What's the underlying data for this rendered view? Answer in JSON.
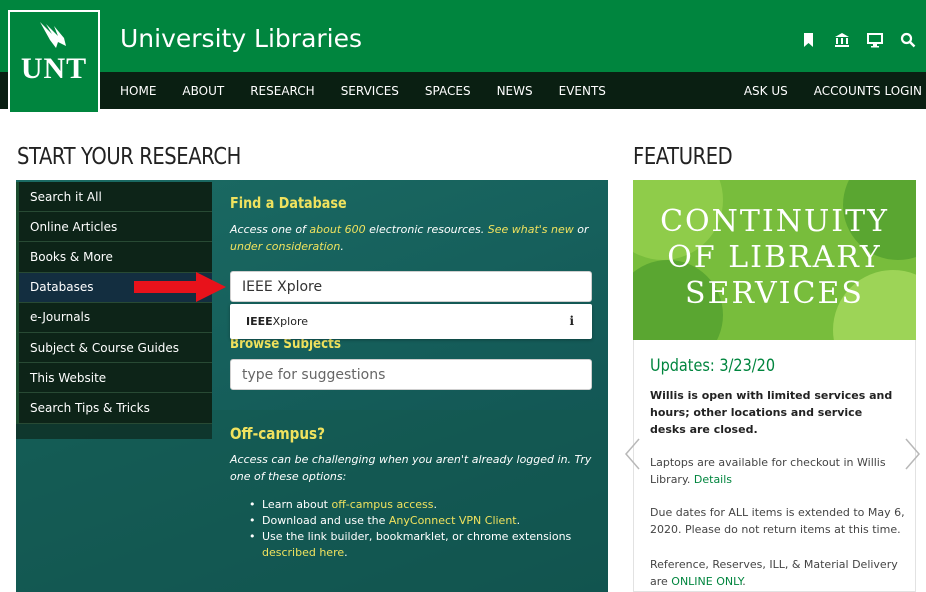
{
  "header": {
    "site_title": "University Libraries",
    "logo_text": "UNT",
    "icons": [
      "bookmark-icon",
      "library-icon",
      "computer-icon",
      "search-icon"
    ],
    "nav_left": [
      "HOME",
      "ABOUT",
      "RESEARCH",
      "SERVICES",
      "SPACES",
      "NEWS",
      "EVENTS"
    ],
    "nav_right": [
      "ASK US",
      "ACCOUNTS LOGIN"
    ]
  },
  "research": {
    "heading": "START YOUR RESEARCH",
    "sidebar": [
      "Search it All",
      "Online Articles",
      "Books & More",
      "Databases",
      "e-Journals",
      "Subject & Course Guides",
      "This Website",
      "Search Tips & Tricks"
    ],
    "active_item": "Databases",
    "find": {
      "title": "Find a Database",
      "desc_1": "Access one of ",
      "link_about": "about 600",
      "desc_2": " electronic resources. ",
      "link_new": "See what's new",
      "desc_3": " or ",
      "link_under": "under consideration",
      "desc_4": ".",
      "input_value": "IEEE Xplore",
      "suggestion_bold": "IEEE",
      "suggestion_rest": " Xplore",
      "suggestion_info": "i"
    },
    "browse": {
      "title": "Browse Subjects",
      "placeholder": "type for suggestions"
    },
    "offcampus": {
      "title": "Off-campus?",
      "desc": "Access can be challenging when you aren't already logged in. Try one of these options:",
      "items": [
        {
          "pre": "Learn about ",
          "link": "off-campus access",
          "post": "."
        },
        {
          "pre": "Download and use the ",
          "link": "AnyConnect VPN Client",
          "post": "."
        },
        {
          "pre": "Use the link builder, bookmarklet, or chrome extensions ",
          "link": "described here",
          "post": "."
        }
      ]
    }
  },
  "featured": {
    "heading": "FEATURED",
    "banner_lines": [
      "CONTINUITY",
      "OF LIBRARY",
      "SERVICES"
    ],
    "update_title": "Updates: 3/23/20",
    "bold_text": "Willis is open with limited services and hours; other locations and service desks are closed.",
    "p1_text": "Laptops are available for checkout in Willis Library. ",
    "p1_link": "Details",
    "p2_text": "Due dates for ALL items is extended to May 6, 2020. Please do not return items at this time.",
    "p3_text": "Reference, Reserves, ILL, & Material Delivery are ",
    "p3_link": "ONLINE ONLY",
    "p3_end": "."
  },
  "colors": {
    "brand_green": "#00853e",
    "nav_dark": "#0a1f12",
    "accent_yellow": "#f0e25e",
    "arrow_red": "#e8121b"
  }
}
